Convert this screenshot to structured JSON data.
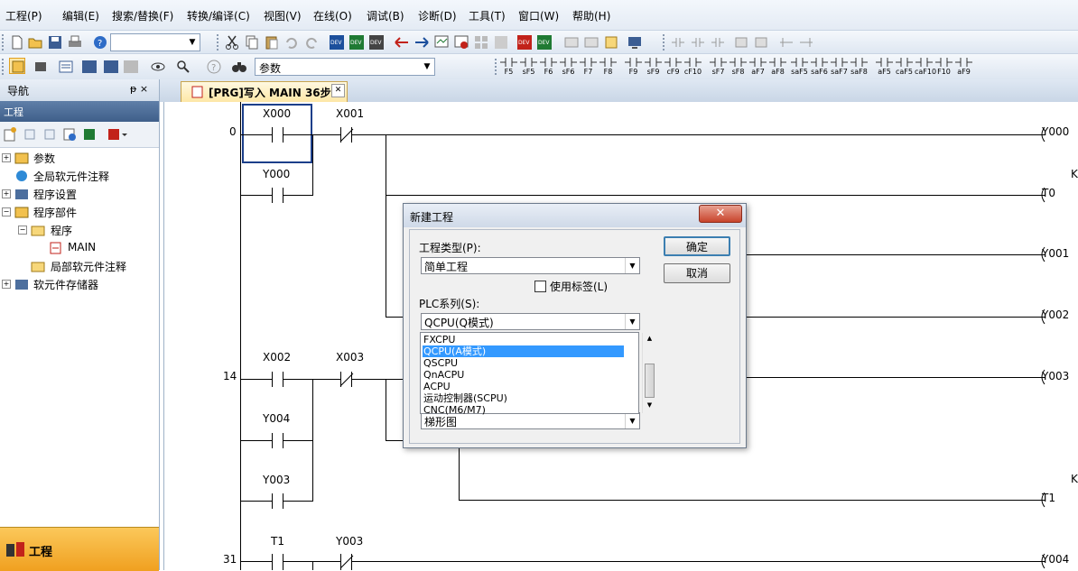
{
  "menu": [
    "工程(P)",
    "编辑(E)",
    "搜索/替换(F)",
    "转换/编译(C)",
    "视图(V)",
    "在线(O)",
    "调试(B)",
    "诊断(D)",
    "工具(T)",
    "窗口(W)",
    "帮助(H)"
  ],
  "toolbar": {
    "combo1_value": "",
    "combo2_value": "参数",
    "fkeys": [
      "F5",
      "sF5",
      "F6",
      "sF6",
      "F7",
      "F8",
      "F9",
      "sF9",
      "cF9",
      "cF10",
      "sF7",
      "sF8",
      "aF7",
      "aF8",
      "saF5",
      "saF6",
      "saF7",
      "saF8",
      "aF5",
      "caF5",
      "caF10",
      "F10",
      "aF9"
    ],
    "icon_labels": [
      "DEV",
      "DEV",
      "DEV",
      "DEV",
      "DEV"
    ]
  },
  "nav": {
    "title": "导航",
    "pin": "ᵽ ×",
    "subtitle": "工程",
    "items": [
      {
        "label": "参数",
        "expander": "+"
      },
      {
        "label": "全局软元件注释",
        "expander": ""
      },
      {
        "label": "程序设置",
        "expander": "+"
      },
      {
        "label": "程序部件",
        "expander": "−"
      },
      {
        "label": "程序",
        "expander": "−"
      },
      {
        "label": "MAIN",
        "expander": ""
      },
      {
        "label": "局部软元件注释",
        "expander": ""
      },
      {
        "label": "软元件存储器",
        "expander": "+"
      }
    ],
    "bottom_label": "工程"
  },
  "tab": {
    "label": "[PRG]写入 MAIN 36步",
    "close": "✕"
  },
  "ladder": {
    "step_numbers": [
      "0",
      "14",
      "31"
    ],
    "contacts": [
      "X000",
      "X001",
      "Y000",
      "X002",
      "X003",
      "Y004",
      "Y003",
      "T1",
      "Y003"
    ],
    "coils": [
      "Y000",
      "T0",
      "Y001",
      "Y002",
      "Y003",
      "T1",
      "Y004"
    ],
    "k_labels": [
      "K",
      "K"
    ]
  },
  "dialog": {
    "title": "新建工程",
    "close": "✕",
    "project_type_label": "工程类型(P):",
    "project_type_value": "简单工程",
    "use_label_text": "使用标签(L)",
    "use_label_checked": false,
    "plc_series_label": "PLC系列(S):",
    "plc_series_value": "QCPU(Q模式)",
    "plc_series_options": [
      "FXCPU",
      "QCPU(A模式)",
      "QSCPU",
      "QnACPU",
      "ACPU",
      "运动控制器(SCPU)",
      "CNC(M6/M7)"
    ],
    "selected_option_index": 1,
    "program_language_value": "梯形图",
    "ok_label": "确定",
    "cancel_label": "取消"
  },
  "colors": {
    "accent": "#3399ff",
    "nav_bottom": "#f0a020",
    "tab": "#fde7a6"
  }
}
